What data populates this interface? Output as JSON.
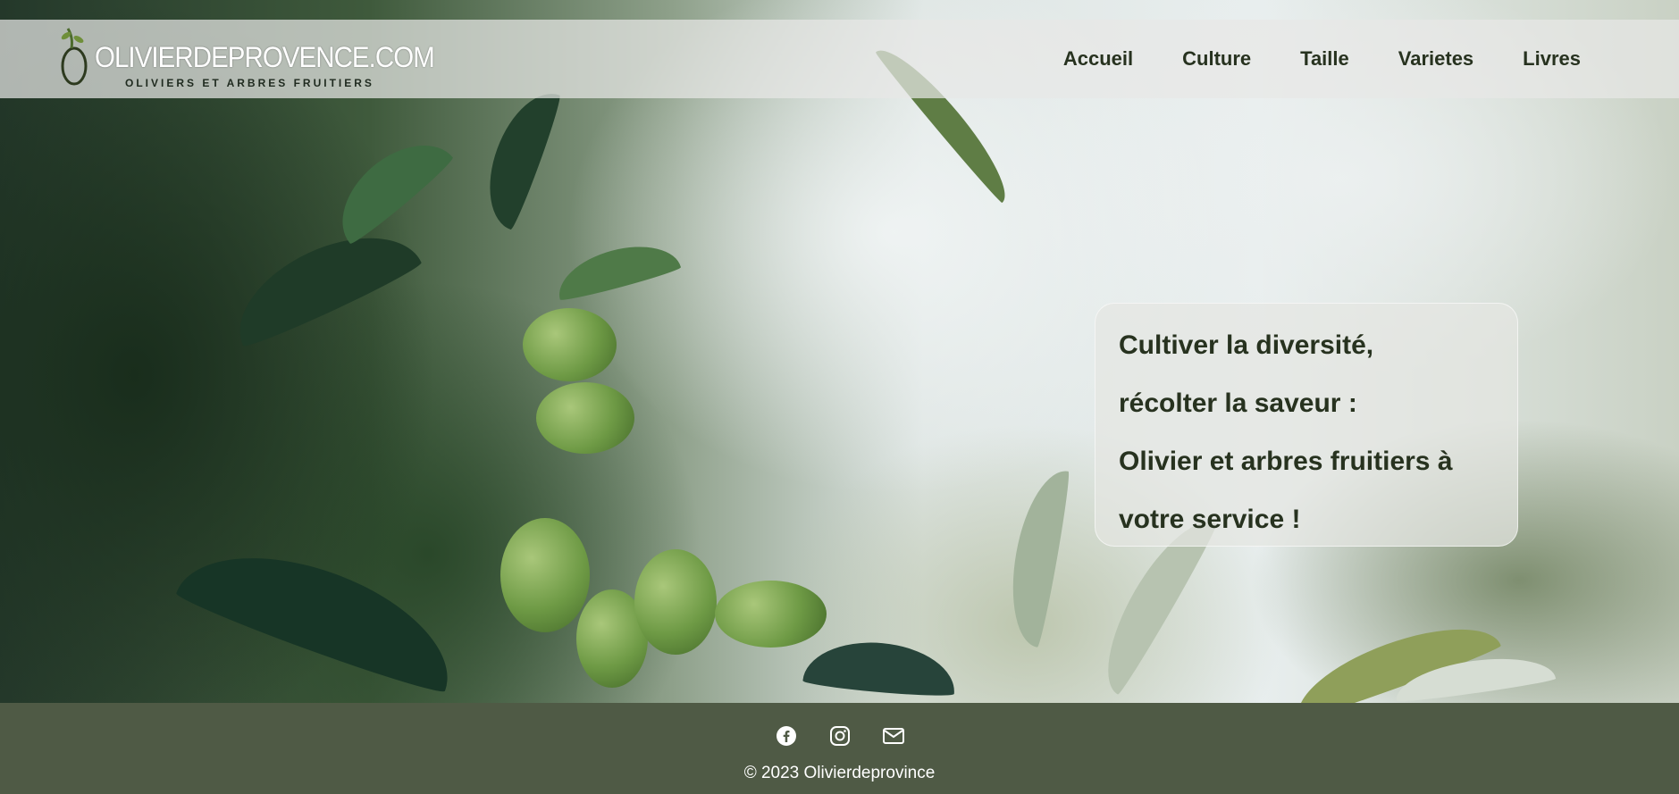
{
  "header": {
    "logo_name": "OLIVIERDEPROVENCE.COM",
    "logo_tagline": "OLIVIERS ET ARBRES FRUITIERS",
    "nav": [
      {
        "label": "Accueil"
      },
      {
        "label": "Culture"
      },
      {
        "label": "Taille"
      },
      {
        "label": "Varietes"
      },
      {
        "label": "Livres"
      }
    ]
  },
  "hero": {
    "lines": [
      "Cultiver la diversité,",
      "récolter la saveur :",
      "Olivier et arbres fruitiers à",
      "votre service !"
    ]
  },
  "footer": {
    "social": [
      {
        "icon": "facebook-icon"
      },
      {
        "icon": "instagram-icon"
      },
      {
        "icon": "mail-icon"
      }
    ],
    "copyright": "© 2023 Olivierdeprovince"
  },
  "colors": {
    "footer_bg": "#4f5a45",
    "text_dark": "#27321f"
  }
}
